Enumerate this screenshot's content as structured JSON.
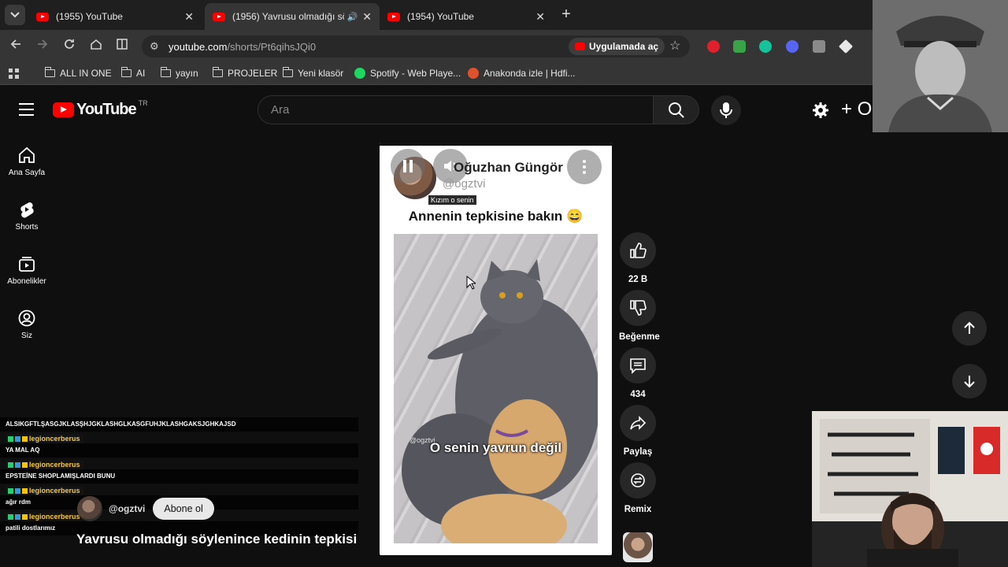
{
  "browser": {
    "tabs": [
      {
        "title": "(1955) YouTube",
        "active": false
      },
      {
        "title": "(1956) Yavrusu olmadığı sö",
        "active": true
      },
      {
        "title": "(1954) YouTube",
        "active": false
      }
    ],
    "url_host": "youtube.com",
    "url_path": "/shorts/Pt6qihsJQi0",
    "open_in_app": "Uygulamada aç",
    "bookmarks": [
      "ALL IN ONE",
      "AI",
      "yayın",
      "PROJELER",
      "Yeni klasör",
      "Spotify - Web Playe...",
      "Anakonda izle | Hdfi..."
    ]
  },
  "youtube": {
    "logo_text": "YouTube",
    "country_code": "TR",
    "search_placeholder": "Ara",
    "create_label": "+ O",
    "sidebar": [
      {
        "label": "Ana Sayfa",
        "icon": "home-icon"
      },
      {
        "label": "Shorts",
        "icon": "shorts-icon"
      },
      {
        "label": "Abonelikler",
        "icon": "subscriptions-icon"
      },
      {
        "label": "Siz",
        "icon": "profile-icon"
      }
    ]
  },
  "short": {
    "channel_name": "Oğuzhan Güngör",
    "channel_handle": "@ogztvi",
    "caption_tag": "Kızım o senin",
    "headline": "Annenin tepkisine bakın 😄",
    "video_text": "O senin yavrun değil",
    "video_watermark": "@ogztvi",
    "actions": {
      "like_count": "22 B",
      "dislike_label": "Beğenme",
      "comment_count": "434",
      "share_label": "Paylaş",
      "remix_label": "Remix"
    },
    "subscribe_handle": "@ogztvi",
    "subscribe_label": "Abone ol",
    "title": "Yavrusu olmadığı söylenince kedinin tepkisi"
  },
  "chat": {
    "messages": [
      {
        "text": "ALSIKGFTLŞASGJKLASŞHJGKLASHGLKASGFUHJKLASHGAKSJGHKAJSD"
      },
      {
        "user": "legioncerberus",
        "text": "YA MAL AQ"
      },
      {
        "user": "legioncerberus",
        "text": "EPSTEİNE SHOPLAMIŞLARDI BUNU"
      },
      {
        "user": "legioncerberus",
        "text": "ağır rdm"
      },
      {
        "user": "legioncerberus",
        "text": "patili dostlarımız"
      }
    ]
  },
  "colors": {
    "accent": "#ff0000",
    "background": "#0f0f0f",
    "chat_user": "#f2c94c"
  }
}
